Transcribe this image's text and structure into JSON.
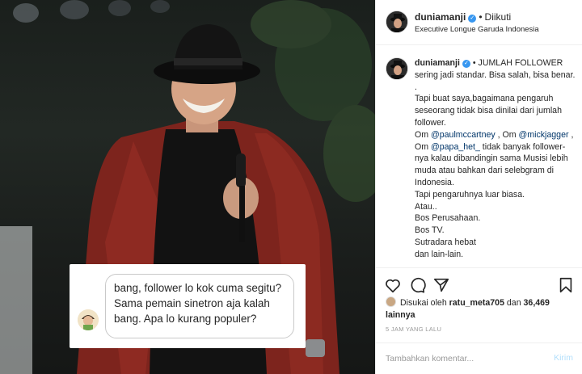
{
  "post": {
    "username": "duniamanji",
    "verified_badge": "verified-check-icon",
    "follow_separator": "•",
    "follow_state": "Diikuti",
    "location": "Executive Longue Garuda Indonesia"
  },
  "photo_overlay": {
    "comment_lines": [
      "bang, follower lo kok cuma segitu?",
      "Sama pemain sinetron aja kalah",
      "bang. Apa lo kurang populer?"
    ]
  },
  "caption": {
    "username": "duniamanji",
    "intro": "• JUMLAH FOLLOWER sering jadi standar. Bisa salah, bisa benar.",
    "dot_line": ".",
    "para1": "Tapi buat saya,bagaimana pengaruh seseorang tidak bisa dinilai dari jumlah follower.",
    "om1_prefix": "Om ",
    "mention1": "@paulmccartney",
    "om1_sep": " , Om ",
    "mention2": "@mickjagger",
    "om2_sep": " , Om ",
    "mention3": "@papa_het_",
    "om3_rest": " tidak banyak follower-nya kalau dibandingin sama Musisi lebih muda atau bahkan dari selebgram di Indonesia.",
    "line_influence": "Tapi pengaruhnya luar biasa.",
    "line_atau": "Atau..",
    "line_bos1": "Bos Perusahaan.",
    "line_bos2": "Bos TV.",
    "line_sutradara": "Sutradara hebat",
    "line_dll": "dan lain-lain."
  },
  "actions": {
    "like_icon": "heart-icon",
    "comment_icon": "comment-icon",
    "share_icon": "share-icon",
    "save_icon": "bookmark-icon"
  },
  "likes": {
    "prefix": "Disukai oleh ",
    "first_user": "ratu_meta705",
    "connector": " dan ",
    "count": "36,469",
    "suffix": " lainnya"
  },
  "time_ago": "5 JAM YANG LALU",
  "comment_box": {
    "placeholder": "Tambahkan komentar...",
    "post_label": "Kirim"
  },
  "colors": {
    "link_blue": "#003569",
    "verified_blue": "#3897f0",
    "post_button_disabled": "#b2dffc",
    "jacket_red": "#8b2a22"
  }
}
